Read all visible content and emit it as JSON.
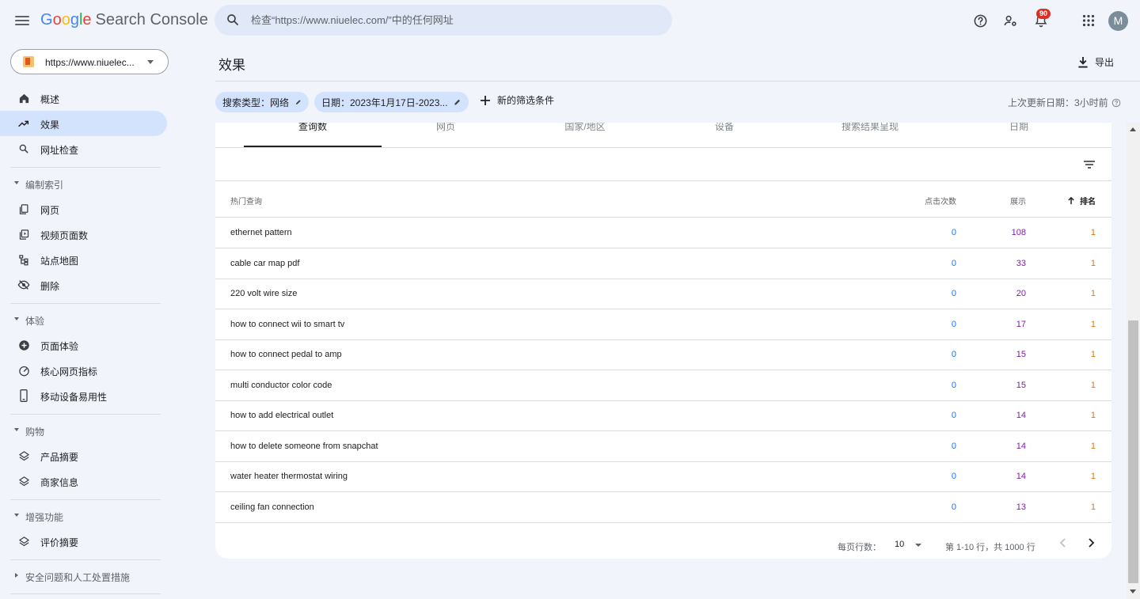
{
  "app": {
    "logo": {
      "g": "G",
      "o1": "o",
      "o2": "o",
      "g2": "g",
      "l": "l",
      "e": "e",
      "product": "Search Console"
    },
    "search_placeholder": "检查“https://www.niuelec.com/”中的任何网址",
    "notification_count": "90",
    "avatar_letter": "M"
  },
  "sidebar": {
    "property": "https://www.niuelec...",
    "top_items": [
      {
        "label": "概述",
        "icon": "home-icon"
      },
      {
        "label": "效果",
        "icon": "trending-up-icon",
        "active": true
      },
      {
        "label": "网址检查",
        "icon": "search-icon"
      }
    ],
    "sections": [
      {
        "title": "编制索引",
        "items": [
          {
            "label": "网页",
            "icon": "pages-icon"
          },
          {
            "label": "视频页面数",
            "icon": "video-page-icon"
          },
          {
            "label": "站点地图",
            "icon": "sitemap-icon"
          },
          {
            "label": "删除",
            "icon": "removal-icon"
          }
        ]
      },
      {
        "title": "体验",
        "items": [
          {
            "label": "页面体验",
            "icon": "page-experience-icon"
          },
          {
            "label": "核心网页指标",
            "icon": "speed-gauge-icon"
          },
          {
            "label": "移动设备易用性",
            "icon": "mobile-icon"
          }
        ]
      },
      {
        "title": "购物",
        "items": [
          {
            "label": "产品摘要",
            "icon": "layers-icon"
          },
          {
            "label": "商家信息",
            "icon": "layers-icon"
          }
        ]
      },
      {
        "title": "增强功能",
        "items": [
          {
            "label": "评价摘要",
            "icon": "layers-icon"
          }
        ]
      },
      {
        "title": "安全问题和人工处置措施",
        "collapsed": true,
        "items": []
      }
    ]
  },
  "main": {
    "title": "效果",
    "export_label": "导出",
    "chips": [
      {
        "label": "搜索类型：网络"
      },
      {
        "label": "日期：2023年1月17日-2023..."
      }
    ],
    "new_filter": "新的筛选条件",
    "last_update": "上次更新日期：3小时前"
  },
  "table": {
    "tabs": [
      "查询数",
      "网页",
      "国家/地区",
      "设备",
      "搜索结果呈现",
      "日期"
    ],
    "active_tab": 0,
    "headers": {
      "query": "热门查询",
      "clicks": "点击次数",
      "impressions": "展示",
      "position": "排名"
    },
    "rows": [
      {
        "query": "ethernet pattern",
        "clicks": "0",
        "impressions": "108",
        "position": "1"
      },
      {
        "query": "cable car map pdf",
        "clicks": "0",
        "impressions": "33",
        "position": "1"
      },
      {
        "query": "220 volt wire size",
        "clicks": "0",
        "impressions": "20",
        "position": "1"
      },
      {
        "query": "how to connect wii to smart tv",
        "clicks": "0",
        "impressions": "17",
        "position": "1"
      },
      {
        "query": "how to connect pedal to amp",
        "clicks": "0",
        "impressions": "15",
        "position": "1"
      },
      {
        "query": "multi conductor color code",
        "clicks": "0",
        "impressions": "15",
        "position": "1"
      },
      {
        "query": "how to add electrical outlet",
        "clicks": "0",
        "impressions": "14",
        "position": "1"
      },
      {
        "query": "how to delete someone from snapchat",
        "clicks": "0",
        "impressions": "14",
        "position": "1"
      },
      {
        "query": "water heater thermostat wiring",
        "clicks": "0",
        "impressions": "14",
        "position": "1"
      },
      {
        "query": "ceiling fan connection",
        "clicks": "0",
        "impressions": "13",
        "position": "1"
      }
    ],
    "pagination": {
      "rows_per_page_label": "每页行数：",
      "rows_per_page": "10",
      "range": "第 1-10 行，共 1000 行"
    }
  },
  "colors": {
    "clicks": "#1a73e8",
    "impressions": "#7b1fa2",
    "position": "#e37400",
    "active_nav": "#d3e3fd"
  }
}
